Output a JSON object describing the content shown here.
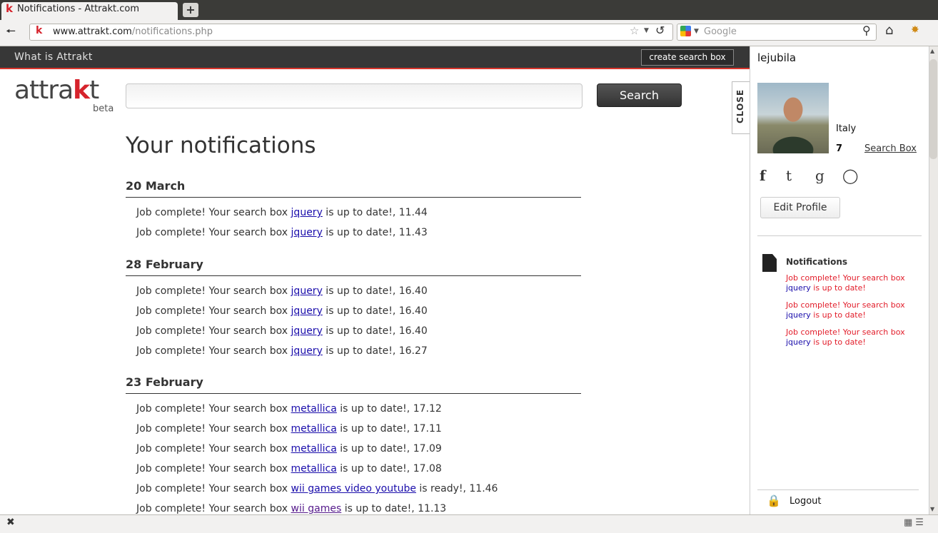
{
  "browser": {
    "tab_title": "Notifications - Attrakt.com",
    "tab_favicon": "k",
    "new_tab": "+",
    "url_domain": "www.attrakt.com",
    "url_path": "/notifications.php",
    "search_placeholder": "Google",
    "icons": [
      "back-arrow-icon",
      "star-icon",
      "reload-icon",
      "google-icon",
      "search-icon",
      "home-icon",
      "extension-icon"
    ]
  },
  "topbar": {
    "what_is": "What is Attrakt",
    "create_button": "create search box"
  },
  "logo": {
    "prefix": "attra",
    "k": "k",
    "suffix": "t",
    "beta": "beta"
  },
  "search": {
    "button": "Search",
    "value": ""
  },
  "page_title": "Your notifications",
  "groups": [
    {
      "date": "20 March",
      "items": [
        {
          "prefix": "Job complete! Your search box ",
          "link": "jquery",
          "suffix": " is up to date!, 11.44"
        },
        {
          "prefix": "Job complete! Your search box ",
          "link": "jquery",
          "suffix": " is up to date!, 11.43"
        }
      ]
    },
    {
      "date": "28 February",
      "items": [
        {
          "prefix": "Job complete! Your search box ",
          "link": "jquery",
          "suffix": " is up to date!, 16.40"
        },
        {
          "prefix": "Job complete! Your search box ",
          "link": "jquery",
          "suffix": " is up to date!, 16.40"
        },
        {
          "prefix": "Job complete! Your search box ",
          "link": "jquery",
          "suffix": " is up to date!, 16.40"
        },
        {
          "prefix": "Job complete! Your search box ",
          "link": "jquery",
          "suffix": " is up to date!, 16.27"
        }
      ]
    },
    {
      "date": "23 February",
      "items": [
        {
          "prefix": "Job complete! Your search box ",
          "link": "metallica",
          "suffix": " is up to date!, 17.12"
        },
        {
          "prefix": "Job complete! Your search box ",
          "link": "metallica",
          "suffix": " is up to date!, 17.11"
        },
        {
          "prefix": "Job complete! Your search box ",
          "link": "metallica",
          "suffix": " is up to date!, 17.09"
        },
        {
          "prefix": "Job complete! Your search box ",
          "link": "metallica",
          "suffix": " is up to date!, 17.08"
        },
        {
          "prefix": "Job complete! Your search box ",
          "link": "wii games video youtube",
          "suffix": " is ready!, 11.46"
        },
        {
          "prefix": "Job complete! Your search box ",
          "link": "wii games",
          "suffix": " is up to date!, 11.13"
        }
      ]
    }
  ],
  "close_tab": "CLOSE",
  "sidebar": {
    "username": "lejubila",
    "country": "Italy",
    "search_box_count": "7",
    "search_box_label": "Search Box",
    "social_icons": [
      "facebook-icon",
      "twitter-icon",
      "google-icon",
      "chat-icon"
    ],
    "edit_profile": "Edit Profile",
    "notifications_heading": "Notifications",
    "notifications": [
      {
        "prefix": "Job complete! Your search box ",
        "link": "jquery",
        "suffix": " is up to date!"
      },
      {
        "prefix": "Job complete! Your search box ",
        "link": "jquery",
        "suffix": " is up to date!"
      },
      {
        "prefix": "Job complete! Your search box ",
        "link": "jquery",
        "suffix": " is up to date!"
      }
    ],
    "logout": "Logout"
  },
  "colors": {
    "brand_red": "#d6232c",
    "link_blue": "#1a0dab",
    "topbar_dark": "#373737"
  }
}
